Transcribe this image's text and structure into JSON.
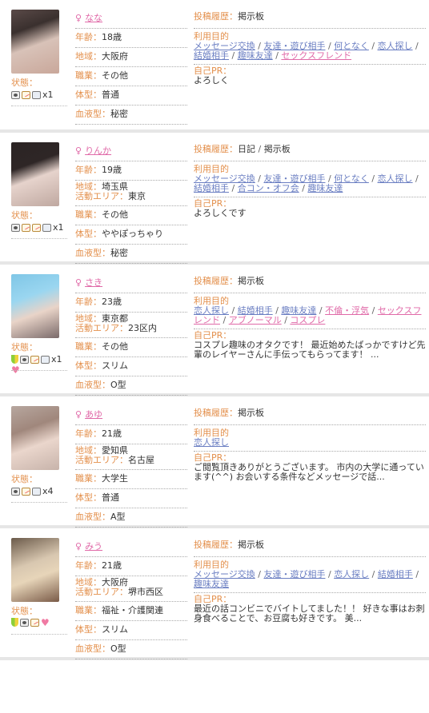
{
  "labels": {
    "status": "状態：",
    "age": "年齢：",
    "region": "地域：",
    "area": "活動エリア：",
    "job": "職業：",
    "body": "体型：",
    "blood": "血液型：",
    "post_history": "投稿履歴：",
    "purpose": "利用目的",
    "pr": "自己PR："
  },
  "female_symbol": "♀",
  "colors": {
    "orange": "#e38f4b",
    "pink": "#e06aa8",
    "blue": "#6a7ec2",
    "divider": "#e6e6e6"
  },
  "profiles": [
    {
      "name": "なな",
      "age": "18歳",
      "region": "大阪府",
      "area": "",
      "job": "その他",
      "body": "普通",
      "blood": "秘密",
      "status_icons": [
        "camera-icon",
        "note-icon",
        "mail-icon"
      ],
      "status_count": "x1",
      "post_history": [
        "掲示板"
      ],
      "purposes": [
        "メッセージ交換",
        "友達・遊び相手",
        "何となく",
        "恋人探し",
        "結婚相手",
        "趣味友達",
        "セックスフレンド"
      ],
      "purpose_pink": [
        6
      ],
      "pr": "よろしく"
    },
    {
      "name": "りんか",
      "age": "19歳",
      "region": "埼玉県",
      "area": "東京",
      "job": "その他",
      "body": "ややぽっちゃり",
      "blood": "秘密",
      "status_icons": [
        "camera-icon",
        "note-icon",
        "note-icon",
        "mail-icon"
      ],
      "status_count": "x1",
      "post_history": [
        "日記",
        "掲示板"
      ],
      "purposes": [
        "メッセージ交換",
        "友達・遊び相手",
        "何となく",
        "恋人探し",
        "結婚相手",
        "合コン・オフ会",
        "趣味友達"
      ],
      "purpose_pink": [],
      "pr": "よろしくです"
    },
    {
      "name": "さき",
      "age": "23歳",
      "region": "東京都",
      "area": "23区内",
      "job": "その他",
      "body": "スリム",
      "blood": "O型",
      "status_icons": [
        "beginner-icon",
        "camera-icon",
        "note-icon",
        "mail-icon"
      ],
      "status_count": "x1",
      "status_heart": true,
      "post_history": [
        "掲示板"
      ],
      "purposes": [
        "恋人探し",
        "結婚相手",
        "趣味友達",
        "不倫・浮気",
        "セックスフレンド",
        "アブノーマル",
        "コスプレ"
      ],
      "purpose_pink": [
        3,
        4,
        5,
        6
      ],
      "pr": "コスプレ趣味のオタクです！ 最近始めたばっかですけど先輩のレイヤーさんに手伝ってもらってます！ ..."
    },
    {
      "name": "あゆ",
      "age": "21歳",
      "region": "愛知県",
      "area": "名古屋",
      "job": "大学生",
      "body": "普通",
      "blood": "A型",
      "status_icons": [
        "camera-icon",
        "note-icon",
        "mail-icon"
      ],
      "status_count": "x4",
      "post_history": [
        "掲示板"
      ],
      "purposes": [
        "恋人探し"
      ],
      "purpose_pink": [],
      "pr": "ご閲覧頂きありがとうございます。 市内の大学に通っています(^^) お会いする条件などメッセージで話..."
    },
    {
      "name": "みう",
      "age": "21歳",
      "region": "大阪府",
      "area": "堺市西区",
      "job": "福祉・介護関連",
      "body": "スリム",
      "blood": "O型",
      "status_icons": [
        "beginner-icon",
        "camera-icon",
        "note-icon"
      ],
      "status_count": "",
      "status_heart": true,
      "post_history": [
        "掲示板"
      ],
      "purposes": [
        "メッセージ交換",
        "友達・遊び相手",
        "恋人探し",
        "結婚相手",
        "趣味友達"
      ],
      "purpose_pink": [],
      "pr": "最近の話コンビニでバイトしてました！！ 好きな事はお刺身食べることで、お豆腐も好きです。 美..."
    }
  ]
}
